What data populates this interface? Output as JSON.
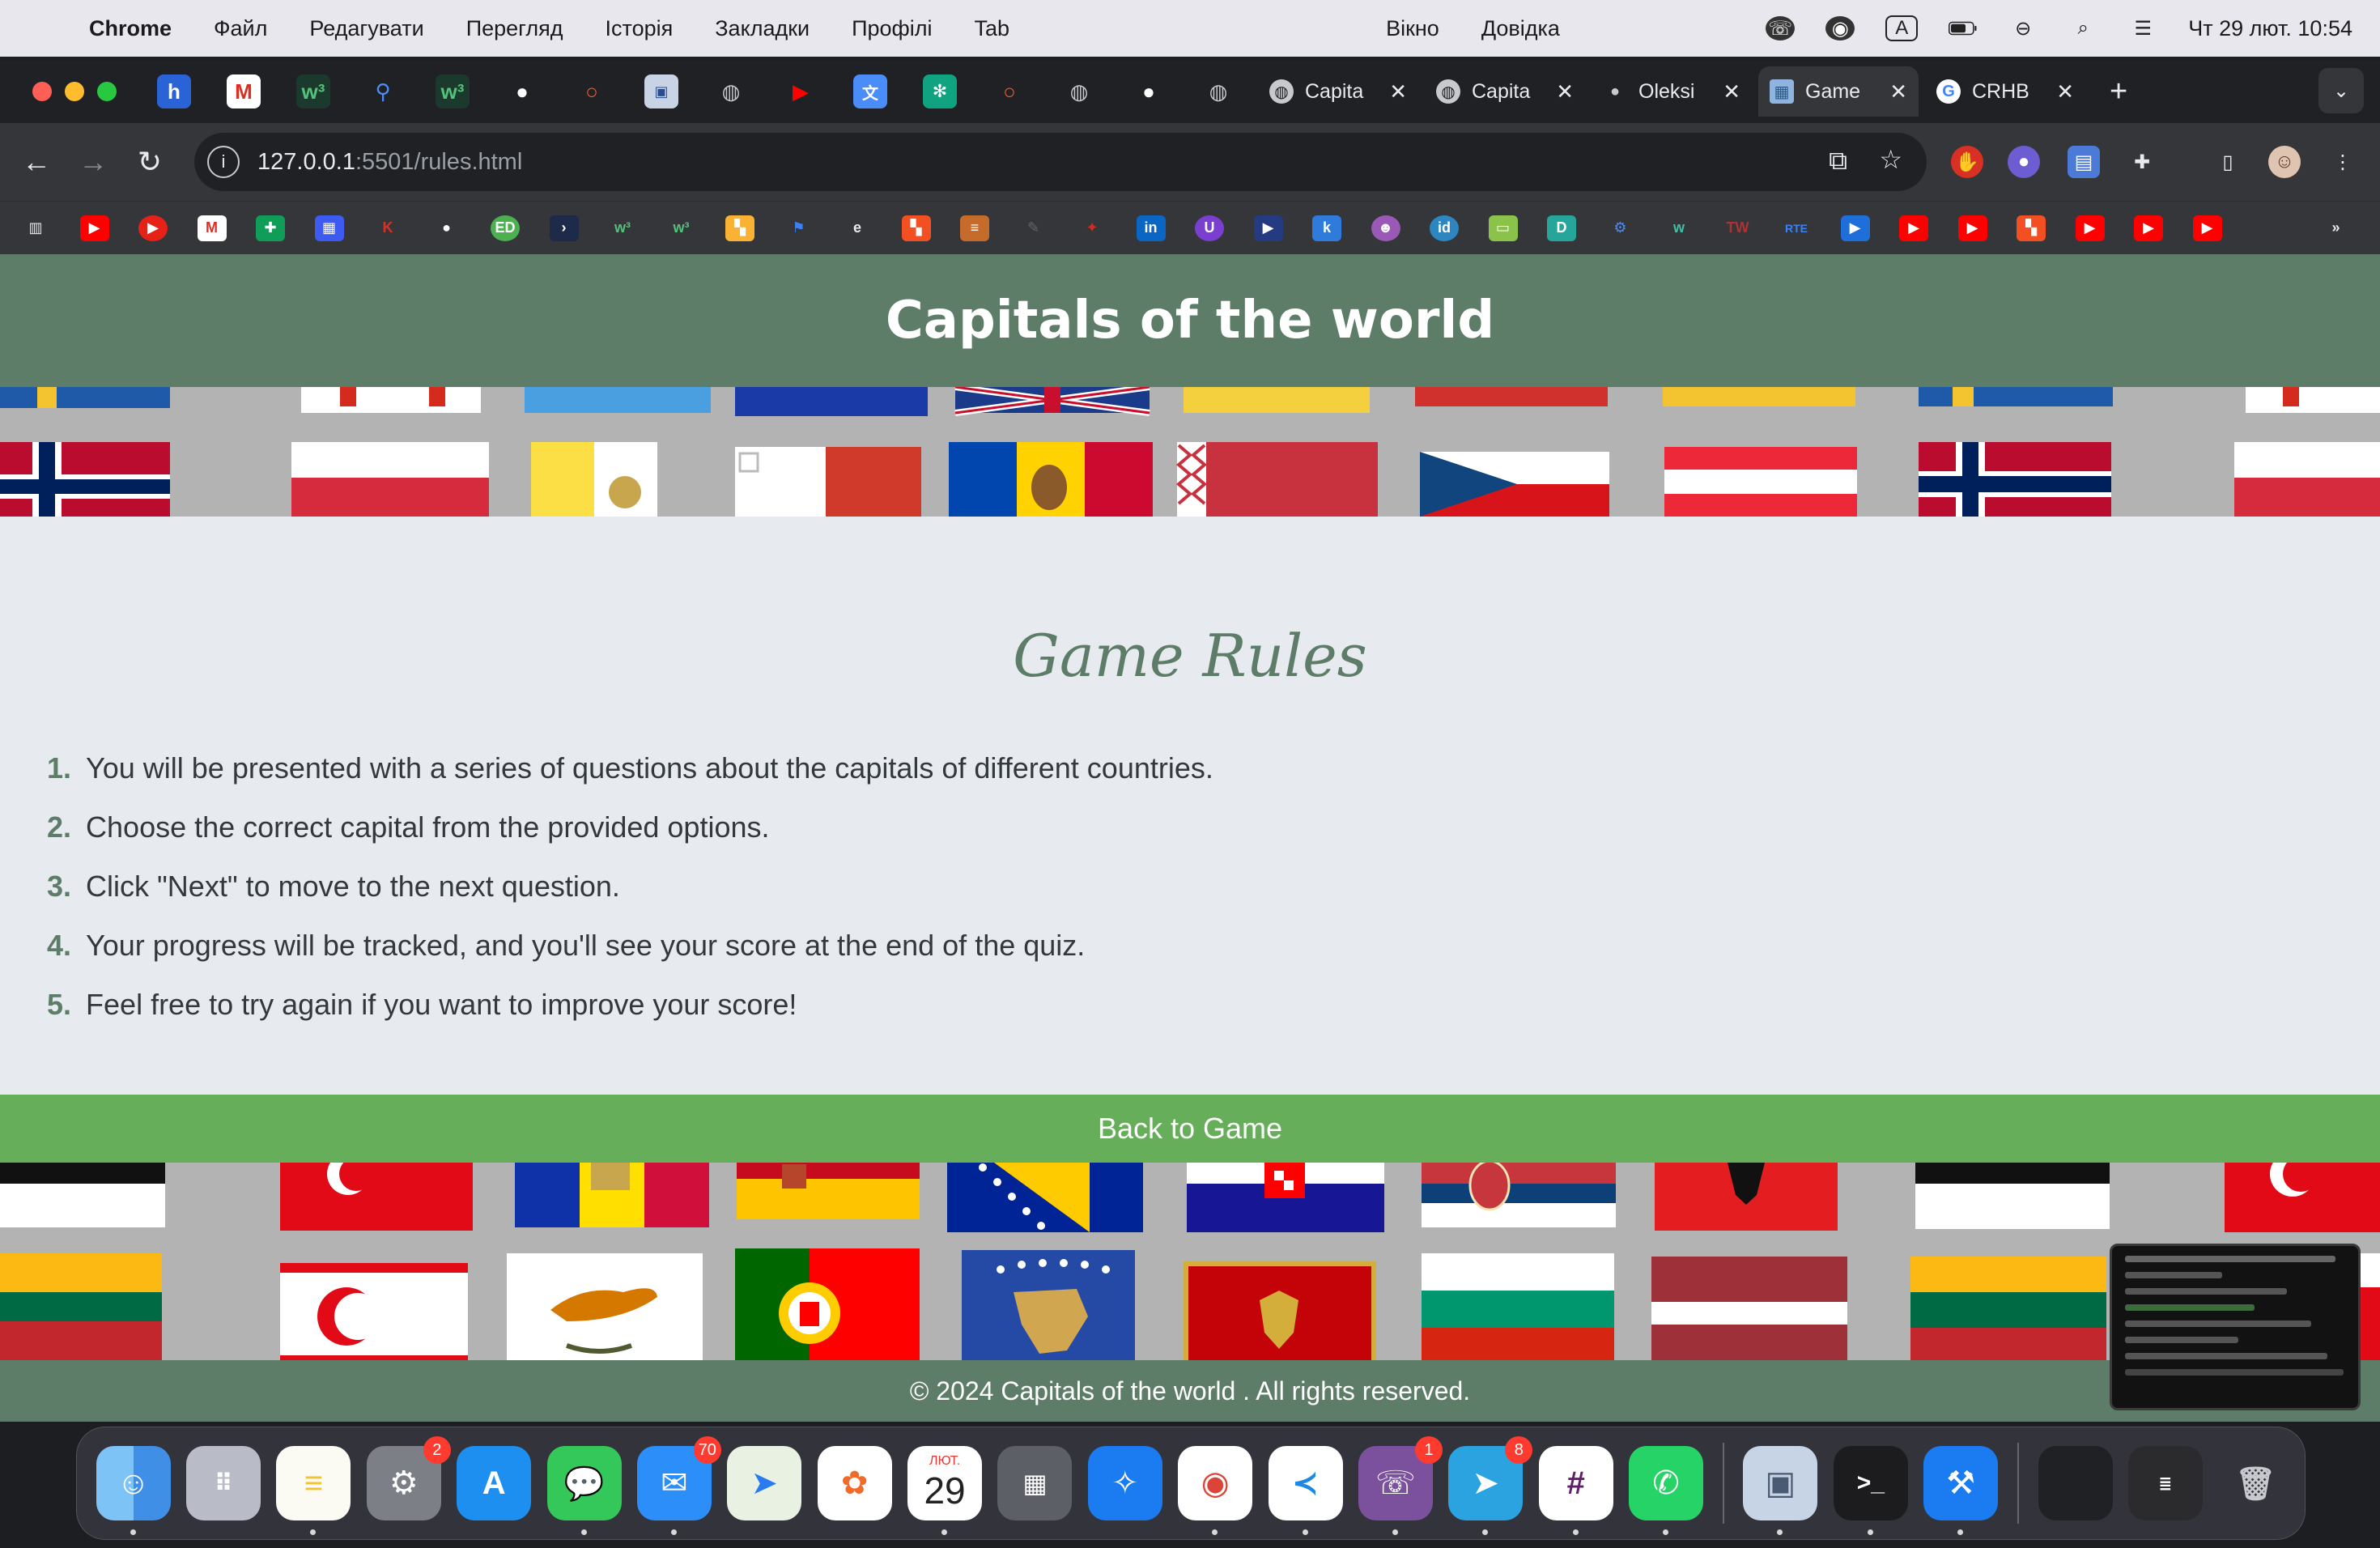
{
  "menubar": {
    "app": "Chrome",
    "items": [
      "Файл",
      "Редагувати",
      "Перегляд",
      "Історія",
      "Закладки",
      "Профілі",
      "Tab",
      "Вікно",
      "Довідка"
    ],
    "keyboard_layout": "A",
    "clock": "Чт 29 лют.  10:54"
  },
  "tabs": [
    {
      "title": "Capita",
      "favicon": "globe-icon"
    },
    {
      "title": "Capita",
      "favicon": "globe-icon"
    },
    {
      "title": "Oleksi",
      "favicon": "github-icon"
    },
    {
      "title": "Game",
      "favicon": "map-icon",
      "active": true
    },
    {
      "title": "CRHB",
      "favicon": "google-icon"
    }
  ],
  "address": {
    "host": "127.0.0.1",
    "path": ":5501/rules.html"
  },
  "page": {
    "title": "Capitals of the world",
    "rules_heading": "Game Rules",
    "rules": [
      {
        "num": "1.",
        "text": "You will be presented with a series of questions about the capitals of different countries."
      },
      {
        "num": "2.",
        "text": "Choose the correct capital from the provided options."
      },
      {
        "num": "3.",
        "text": "Click \"Next\" to move to the next question."
      },
      {
        "num": "4.",
        "text": "Your progress will be tracked, and you'll see your score at the end of the quiz."
      },
      {
        "num": "5.",
        "text": "Feel free to try again if you want to improve your score!"
      }
    ],
    "back_button": "Back to Game",
    "footer": "© 2024 Capitals of the world . All rights reserved."
  },
  "dock": {
    "calendar_month": "ЛЮТ.",
    "calendar_day": "29",
    "badges": {
      "settings": "2",
      "mail": "70",
      "viber": "1",
      "telegram": "8"
    }
  },
  "colors": {
    "header_green": "#5d7d69",
    "button_green": "#66ae5a",
    "page_bg": "#e7ebef"
  }
}
